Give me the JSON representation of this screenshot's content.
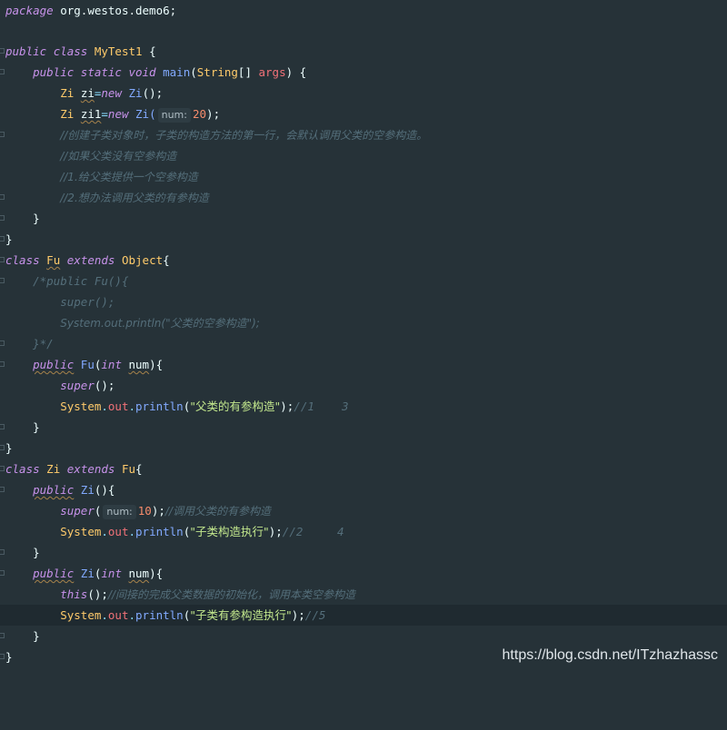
{
  "code": {
    "package_kw": "package",
    "package_name": "org.westos.demo6;",
    "l3": {
      "kw1": "public",
      "kw2": "class",
      "name": "MyTest1",
      "brace": " {"
    },
    "l4": {
      "kw1": "public",
      "kw2": "static",
      "kw3": "void",
      "fn": "main",
      "p1": "(",
      "type": "String",
      "arr": "[] ",
      "arg": "args",
      "p2": ") {"
    },
    "l5": {
      "type": "Zi",
      "var": "zi",
      "eq": "=",
      "kw": "new",
      "cls": "Zi",
      "end": "();"
    },
    "l6": {
      "type": "Zi",
      "var": "zi1",
      "eq": "=",
      "kw": "new",
      "cls": "Zi(",
      "hint": "num:",
      "num": "20",
      "end": ");"
    },
    "l7": "//创建子类对象时，子类的构造方法的第一行，会默认调用父类的空参构造。",
    "l8": "//如果父类没有空参构造",
    "l9": "//1.给父类提供一个空参构造",
    "l10": "//2.想办法调用父类的有参构造",
    "l11": "}",
    "l12": "}",
    "l13": {
      "kw1": "class",
      "name": "Fu",
      "kw2": "extends",
      "sup": "Object",
      "brace": "{"
    },
    "l14": "/*public Fu(){",
    "l15": "super();",
    "l16": "System.out.println(\"父类的空参构造\");",
    "l17": "}*/",
    "l18": {
      "kw": "public",
      "fn": "Fu",
      "p1": "(",
      "type": "int",
      "arg": "num",
      "p2": "){"
    },
    "l19": {
      "kw": "super",
      "end": "();"
    },
    "l20": {
      "sys": "System",
      "dot1": ".",
      "out": "out",
      "dot2": ".",
      "fn": "println",
      "p1": "(",
      "str": "\"父类的有参构造\"",
      "p2": ");",
      "cm": "//1    3"
    },
    "l21": "}",
    "l22": "}",
    "l23": {
      "kw1": "class",
      "name": "Zi",
      "kw2": "extends",
      "sup": "Fu",
      "brace": "{"
    },
    "l24": {
      "kw": "public",
      "fn": "Zi",
      "end": "(){"
    },
    "l25": {
      "kw": "super",
      "p1": "(",
      "hint": "num:",
      "num": "10",
      "p2": ");",
      "cm": "//调用父类的有参构造"
    },
    "l26": {
      "sys": "System",
      "dot1": ".",
      "out": "out",
      "dot2": ".",
      "fn": "println",
      "p1": "(",
      "str": "\"子类构造执行\"",
      "p2": ");",
      "cm": "//2     4"
    },
    "l27": "}",
    "l28": {
      "kw": "public",
      "fn": "Zi",
      "p1": "(",
      "type": "int",
      "arg": "num",
      "p2": "){"
    },
    "l29": {
      "kw": "this",
      "end": "();",
      "cm": "//间接的完成父类数据的初始化，调用本类空参构造"
    },
    "l30": {
      "sys": "System",
      "dot1": ".",
      "out": "out",
      "dot2": ".",
      "fn": "println",
      "p1": "(",
      "str": "\"子类有参构造执行\"",
      "p2": ");",
      "cm": "//5"
    },
    "l31": "}",
    "l32": "}"
  },
  "watermark": "https://blog.csdn.net/ITzhazhassc",
  "colors": {
    "background": "#263238",
    "keyword": "#c792ea",
    "class": "#ffcb6b",
    "function": "#82aaff",
    "string": "#c3e88d",
    "number": "#f78c6c",
    "comment": "#546e7a"
  }
}
